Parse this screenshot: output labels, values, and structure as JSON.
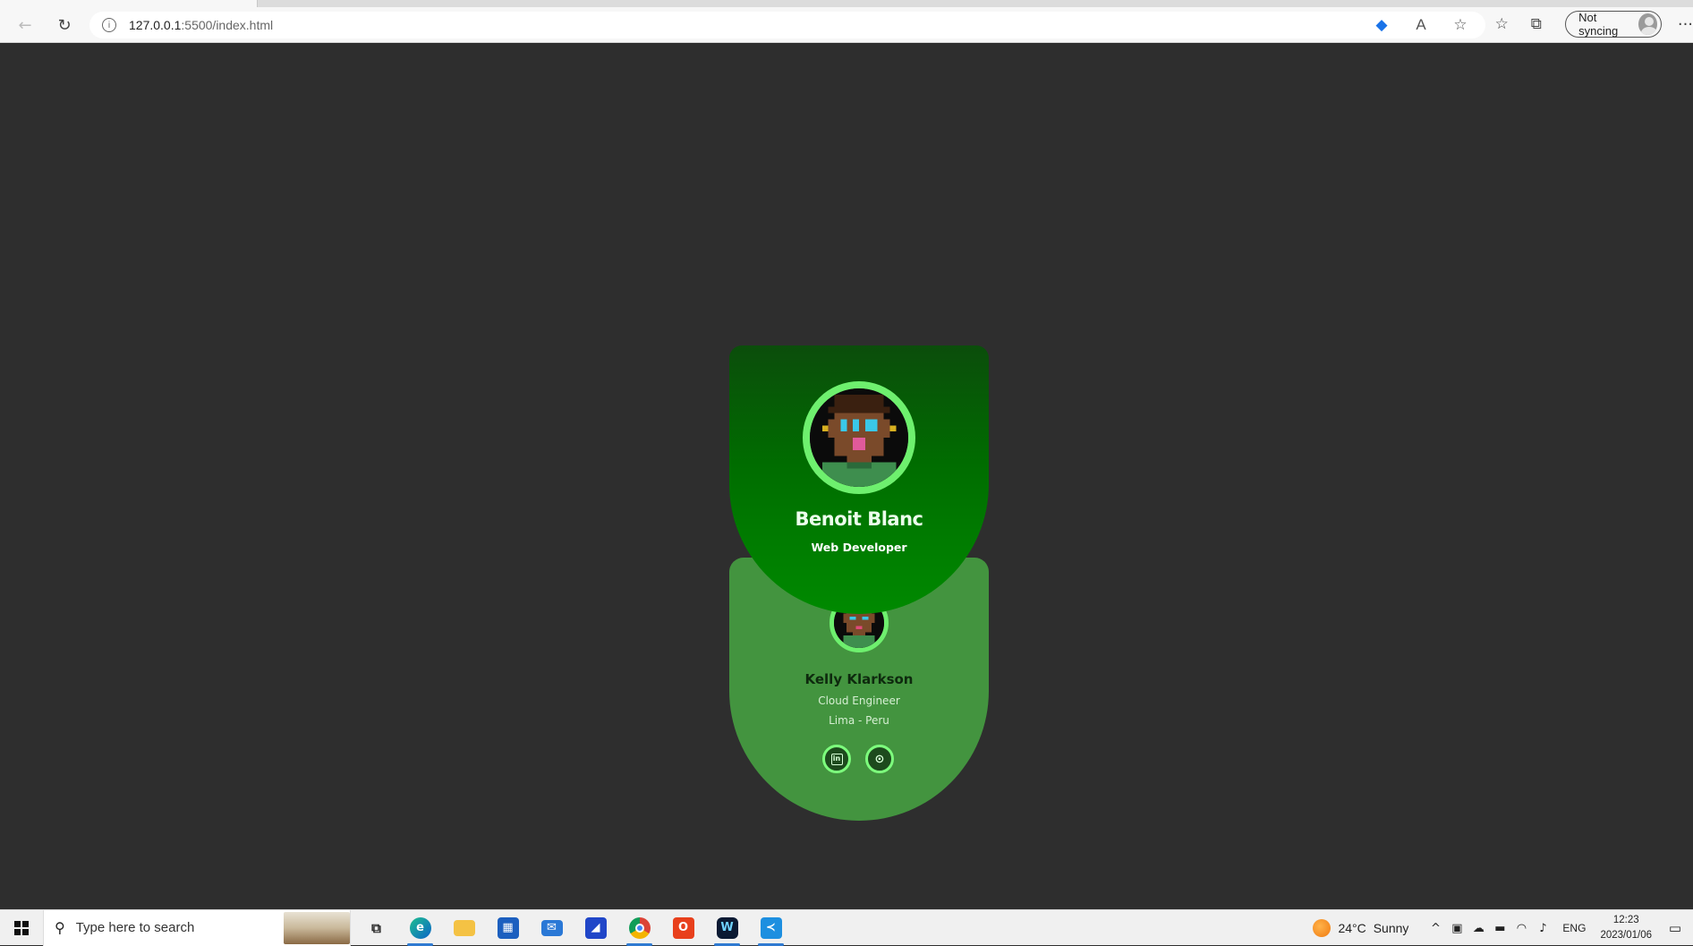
{
  "browser": {
    "url_host": "127.0.0.1",
    "url_path": ":5500/index.html",
    "sync_label": "Not syncing",
    "icons": [
      "back-arrow-icon",
      "refresh-icon",
      "info-icon",
      "shopping-tag-icon",
      "read-aloud-icon",
      "favorite-add-icon",
      "favorites-icon",
      "collections-icon",
      "profile-avatar-icon",
      "more-options-icon"
    ]
  },
  "profile_card": {
    "name": "Benoit Blanc",
    "role": "Web Developer"
  },
  "detail_card": {
    "name": "Kelly Klarkson",
    "role": "Cloud Engineer",
    "location": "Lima - Peru",
    "social": [
      "linkedin-icon",
      "github-icon"
    ]
  },
  "taskbar": {
    "search_placeholder": "Type here to search",
    "apps": [
      "task-view",
      "edge",
      "file-explorer",
      "microsoft-store",
      "mail",
      "azure-data-studio",
      "chrome",
      "office",
      "webex",
      "vscode"
    ],
    "weather": {
      "temp": "24°C",
      "condition": "Sunny"
    },
    "language": "ENG",
    "time": "12:23",
    "date": "2023/01/06"
  },
  "colors": {
    "page_bg": "#2e2e2e",
    "top_card": "#008a00",
    "bottom_card": "#43943f",
    "ring": "#6ef06e"
  }
}
